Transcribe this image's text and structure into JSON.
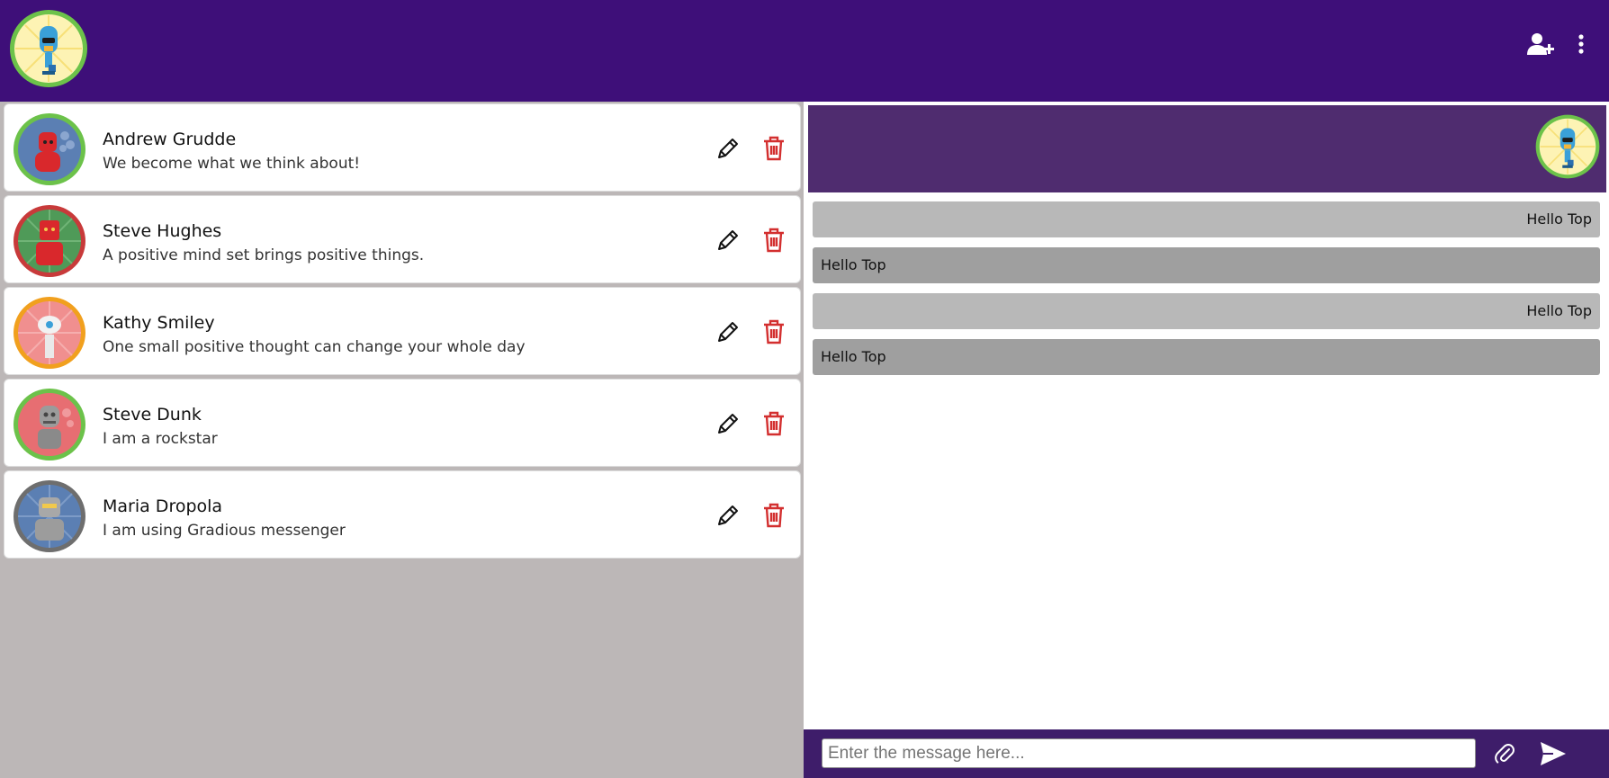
{
  "header": {
    "logo_icon": "robot-logo-icon",
    "add_user_icon": "add-user-icon",
    "menu_icon": "kebab-menu-icon",
    "color": "#3e0f79"
  },
  "contacts": [
    {
      "name": "Andrew Grudde",
      "status": "We become what we think about!",
      "ring": "#6cc24a",
      "bg": "#5b7fb3",
      "robot": "#d9282c"
    },
    {
      "name": "Steve Hughes",
      "status": "A positive mind set brings positive things.",
      "ring": "#c83a3a",
      "bg": "#4f9a58",
      "robot": "#d9282c"
    },
    {
      "name": "Kathy Smiley",
      "status": "One small positive thought can change your whole day",
      "ring": "#f1a01e",
      "bg": "#f08f8f",
      "robot": "#f2f2f2"
    },
    {
      "name": "Steve Dunk",
      "status": "I am a rockstar",
      "ring": "#6cc24a",
      "bg": "#e76e72",
      "robot": "#9b9b9b"
    },
    {
      "name": "Maria Dropola",
      "status": "I am using Gradious messenger",
      "ring": "#6e6e6e",
      "bg": "#5b7fb3",
      "robot": "#a8a8a8"
    }
  ],
  "chat": {
    "header_avatar": "robot-logo-icon",
    "messages": [
      {
        "text": "Hello Top",
        "direction": "sent"
      },
      {
        "text": "Hello Top",
        "direction": "received"
      },
      {
        "text": "Hello Top",
        "direction": "sent"
      },
      {
        "text": "Hello Top",
        "direction": "received"
      }
    ]
  },
  "composer": {
    "placeholder": "Enter the message here...",
    "attach_icon": "paperclip-icon",
    "send_icon": "send-icon"
  }
}
